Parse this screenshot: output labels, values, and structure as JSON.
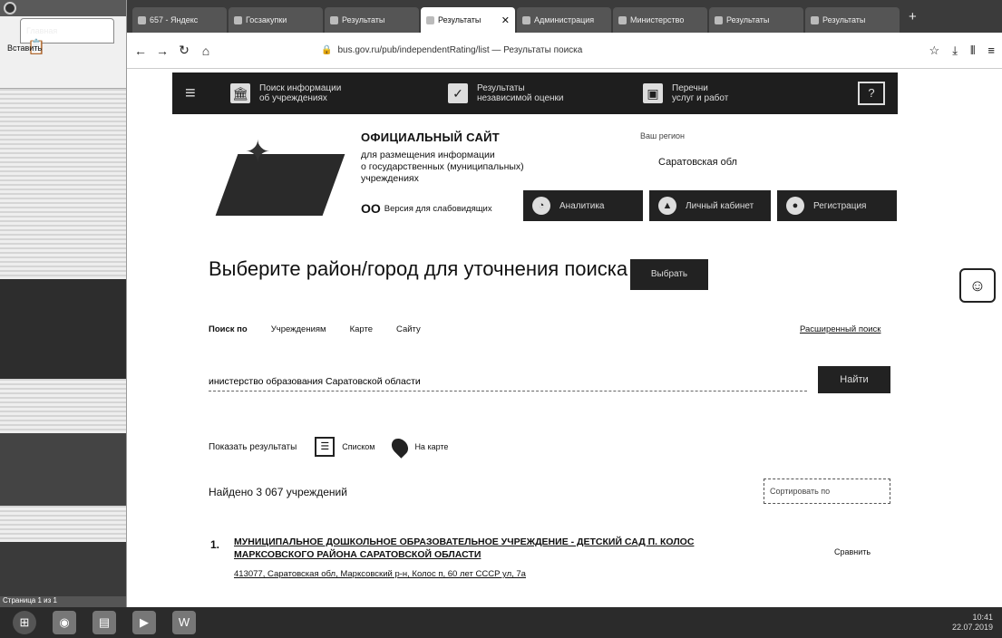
{
  "office": {
    "tab_label": "Главная",
    "paste_label": "Вставить",
    "status_text": "Страница 1 из 1"
  },
  "browser": {
    "tabs": [
      {
        "label": "657 - Яндекс"
      },
      {
        "label": "Госзакупки"
      },
      {
        "label": "Результаты"
      },
      {
        "label": "Результаты",
        "active": true
      },
      {
        "label": "Администрация"
      },
      {
        "label": "Министерство"
      },
      {
        "label": "Результаты"
      },
      {
        "label": "Результаты"
      }
    ],
    "url": "bus.gov.ru/pub/independentRating/list — Результаты поиска",
    "new_tab_symbol": "+"
  },
  "site_nav": {
    "item1": "Поиск информации\nоб учреждениях",
    "item2": "Результаты\nнезависимой оценки",
    "item3": "Перечни\nуслуг и работ"
  },
  "header": {
    "title": "ОФИЦИАЛЬНЫЙ САЙТ",
    "subtitle": "для размещения информации\nо государственных (муниципальных)\nучреждениях",
    "region_label": "Ваш регион",
    "region_value": "Саратовская обл",
    "blind_version": "Версия для слабовидящих",
    "btn_a": "Аналитика",
    "btn_b": "Личный кабинет",
    "btn_c": "Регистрация"
  },
  "search": {
    "heading": "Выберите район/город для уточнения поиска",
    "select_button": "Выбрать",
    "search_by_label": "Поиск по",
    "tab_institutions": "Учреждениям",
    "tab_map": "Карте",
    "tab_site": "Сайту",
    "advanced": "Расширенный поиск",
    "query": "инистерство образования Саратовской области",
    "find_button": "Найти",
    "show_results_label": "Показать результаты",
    "opt_list": "Списком",
    "opt_map": "На карте"
  },
  "results": {
    "found_text": "Найдено 3 067 учреждений",
    "sort_label": "Сортировать по",
    "items": [
      {
        "num": "1.",
        "title": "МУНИЦИПАЛЬНОЕ ДОШКОЛЬНОЕ ОБРАЗОВАТЕЛЬНОЕ УЧРЕЖДЕНИЕ - ДЕТСКИЙ САД П. КОЛОС МАРКСОВСКОГО РАЙОНА САРАТОВСКОЙ ОБЛАСТИ",
        "address": "413077, Саратовская обл, Марксовский р-н, Колос п, 60 лет СССР ул, 7а",
        "compare": "Сравнить"
      }
    ]
  },
  "taskbar": {
    "clock": "10:41\n22.07.2019"
  }
}
